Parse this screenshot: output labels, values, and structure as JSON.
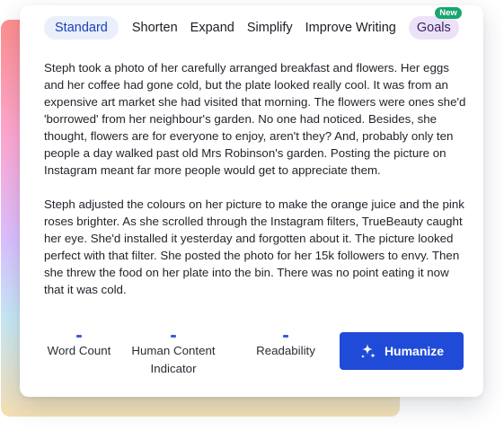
{
  "tabs": {
    "standard": "Standard",
    "shorten": "Shorten",
    "expand": "Expand",
    "simplify": "Simplify",
    "improve_writing": "Improve Writing",
    "goals": "Goals",
    "goals_badge": "New"
  },
  "body": {
    "paragraph_1": "Steph took a photo of her carefully arranged breakfast and flowers. Her eggs and her coffee had gone cold, but the plate looked really cool. It was from an expensive art market she had visited that morning. The flowers were ones she'd 'borrowed' from her neighbour's garden. No one had noticed. Besides, she thought, flowers are for everyone to enjoy, aren't they? And, probably only ten people a day walked past old Mrs Robinson's garden. Posting the picture on Instagram meant far more people would get to appreciate them.",
    "paragraph_2": "Steph adjusted the colours on her picture to make the orange juice and the pink roses brighter. As she scrolled through the Instagram filters, TrueBeauty caught her eye. She'd installed it yesterday and forgotten about it. The picture looked perfect with that filter. She posted the photo for her 15k followers to envy. Then she threw the food on her plate into the bin. There was no point eating it now that it was cold."
  },
  "metrics": {
    "word_count": "Word Count",
    "human_content_line1": "Human Content",
    "human_content_line2": "Indicator",
    "readability": "Readability"
  },
  "actions": {
    "humanize_label": "Humanize",
    "humanize_icon": "sparkle-icon"
  },
  "colors": {
    "accent": "#1f4bd8",
    "active_tab_bg": "#e9effb",
    "goals_tab_bg": "#ece2f8",
    "new_badge": "#19a66c"
  }
}
